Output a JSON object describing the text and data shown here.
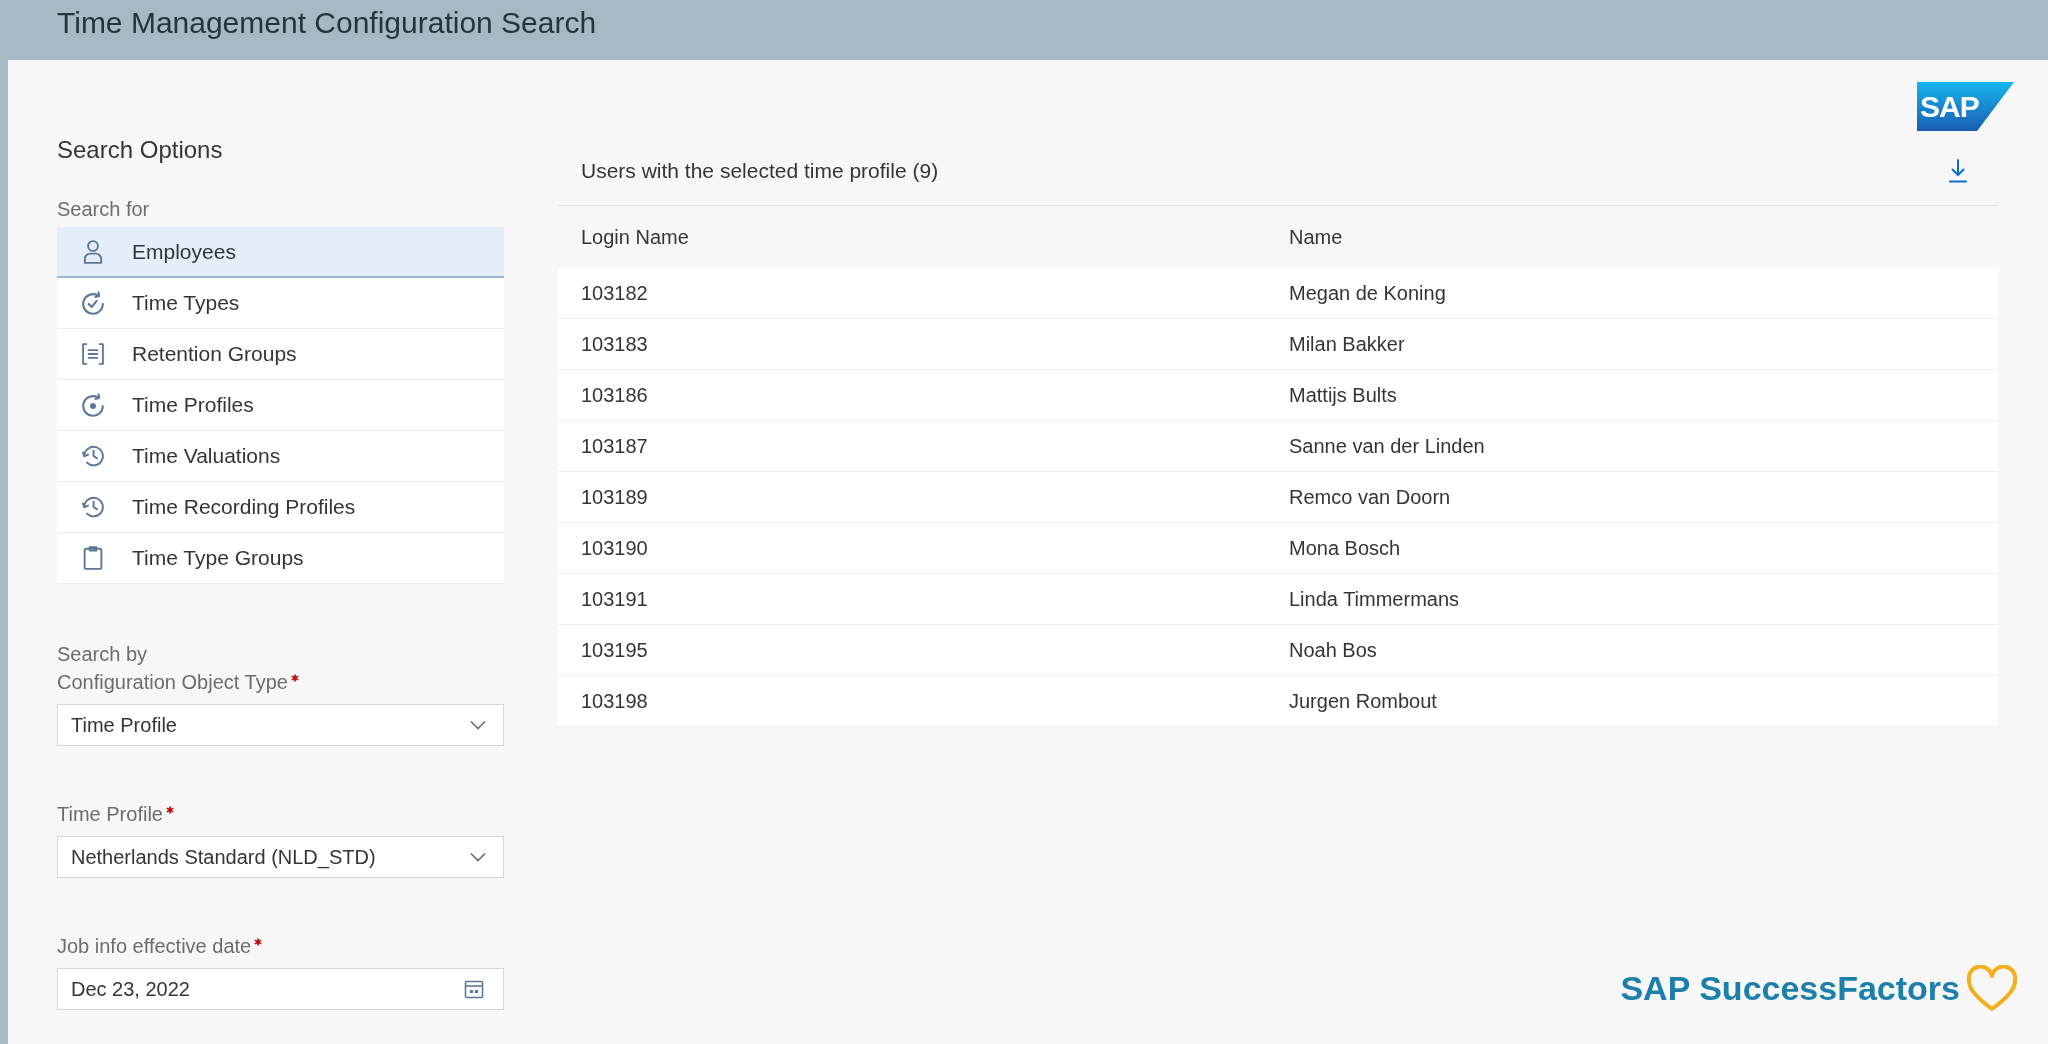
{
  "window": {
    "title": "Time Management Configuration Search"
  },
  "brand": {
    "logo_text": "SAP"
  },
  "search_options": {
    "title": "Search Options",
    "list_label": "Search for",
    "items": [
      {
        "label": "Employees",
        "selected": true
      },
      {
        "label": "Time Types",
        "selected": false
      },
      {
        "label": "Retention Groups",
        "selected": false
      },
      {
        "label": "Time Profiles",
        "selected": false
      },
      {
        "label": "Time Valuations",
        "selected": false
      },
      {
        "label": "Time Recording Profiles",
        "selected": false
      },
      {
        "label": "Time Type Groups",
        "selected": false
      }
    ]
  },
  "form": {
    "fields": [
      {
        "kind": "select",
        "label": [
          "Search by",
          "Configuration Object Type"
        ],
        "required": true,
        "value": "Time Profile"
      },
      {
        "kind": "select",
        "label": [
          "Time Profile"
        ],
        "required": true,
        "value": "Netherlands Standard (NLD_STD)"
      },
      {
        "kind": "date",
        "label": [
          "Job info effective date"
        ],
        "required": true,
        "value": "Dec 23, 2022"
      }
    ]
  },
  "results": {
    "title": "Users with the selected time profile (9)",
    "table": {
      "columns": [
        "Login Name",
        "Name"
      ],
      "rows": [
        [
          "103182",
          "Megan de Koning"
        ],
        [
          "103183",
          "Milan Bakker"
        ],
        [
          "103186",
          "Mattijs Bults"
        ],
        [
          "103187",
          "Sanne van der Linden"
        ],
        [
          "103189",
          "Remco van Doorn"
        ],
        [
          "103190",
          "Mona Bosch"
        ],
        [
          "103191",
          "Linda Timmermans"
        ],
        [
          "103195",
          "Noah Bos"
        ],
        [
          "103198",
          "Jurgen Rombout"
        ]
      ]
    }
  },
  "footer": {
    "brand_text": "SAP SuccessFactors"
  }
}
